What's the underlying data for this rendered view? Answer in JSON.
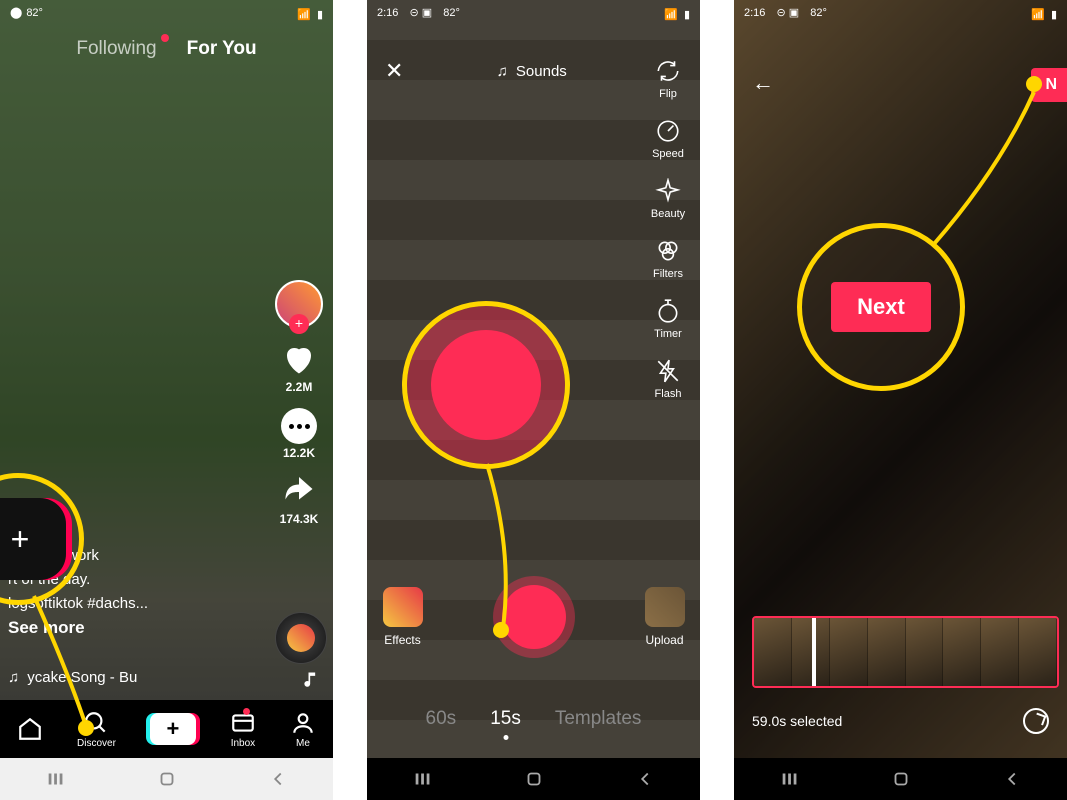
{
  "status_time": "2:16",
  "status_temp": "82°",
  "phone1": {
    "tab_following": "Following",
    "tab_foryou": "For You",
    "like_count": "2.2M",
    "comment_count": "12.2K",
    "share_count": "174.3K",
    "caption_line1": "me from work",
    "caption_line2": "rt of the day.",
    "caption_tags": "logsoftiktok #dachs...",
    "see_more": "See more",
    "song": "ycake Song - Bu",
    "nav_discover": "Discover",
    "nav_inbox": "Inbox",
    "nav_me": "Me"
  },
  "phone2": {
    "sounds": "Sounds",
    "tools": {
      "flip": "Flip",
      "speed": "Speed",
      "beauty": "Beauty",
      "filters": "Filters",
      "timer": "Timer",
      "flash": "Flash"
    },
    "effects": "Effects",
    "upload": "Upload",
    "dur_60": "60s",
    "dur_15": "15s",
    "dur_tpl": "Templates"
  },
  "phone3": {
    "next": "N",
    "next_big": "Next",
    "selected": "59.0s selected"
  }
}
